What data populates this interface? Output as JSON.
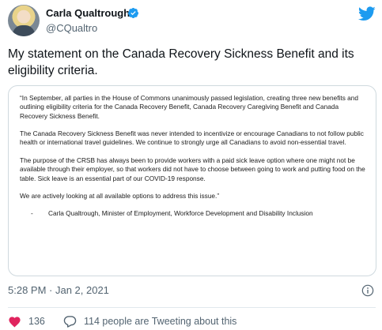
{
  "author": {
    "name": "Carla Qualtrough",
    "handle": "@CQualtro",
    "verified": true
  },
  "tweet": {
    "text": "My statement on the Canada Recovery Sickness Benefit and its eligibility criteria."
  },
  "media": {
    "paragraphs": [
      "“In September, all parties in the House of Commons unanimously passed legislation, creating three new benefits and outlining eligibility criteria for the Canada Recovery Benefit, Canada Recovery Caregiving Benefit and Canada Recovery Sickness Benefit.",
      "The Canada Recovery Sickness Benefit was never intended to incentivize or encourage Canadians to not follow public health or international travel guidelines. We continue to strongly urge all Canadians to avoid non-essential travel.",
      "The purpose of the CRSB has always been to provide workers with a paid sick leave option where one might not be available through their employer, so that workers did not have to choose between going to work and putting food on the table. Sick leave is an essential part of our COVID-19 response.",
      "We are actively looking at all available options to address this issue.”"
    ],
    "signature_dash": "-",
    "signature": "Carla Qualtrough, Minister of Employment, Workforce Development and Disability Inclusion"
  },
  "meta": {
    "timestamp": "5:28 PM · Jan 2, 2021"
  },
  "actions": {
    "like_count": "136",
    "reply_text": "114 people are Tweeting about this"
  },
  "colors": {
    "twitter_blue": "#1d9bf0",
    "like_red": "#e0245e",
    "muted": "#536471"
  },
  "icons": [
    "verified-icon",
    "twitter-bird-icon",
    "info-icon",
    "heart-icon",
    "reply-bubble-icon"
  ]
}
